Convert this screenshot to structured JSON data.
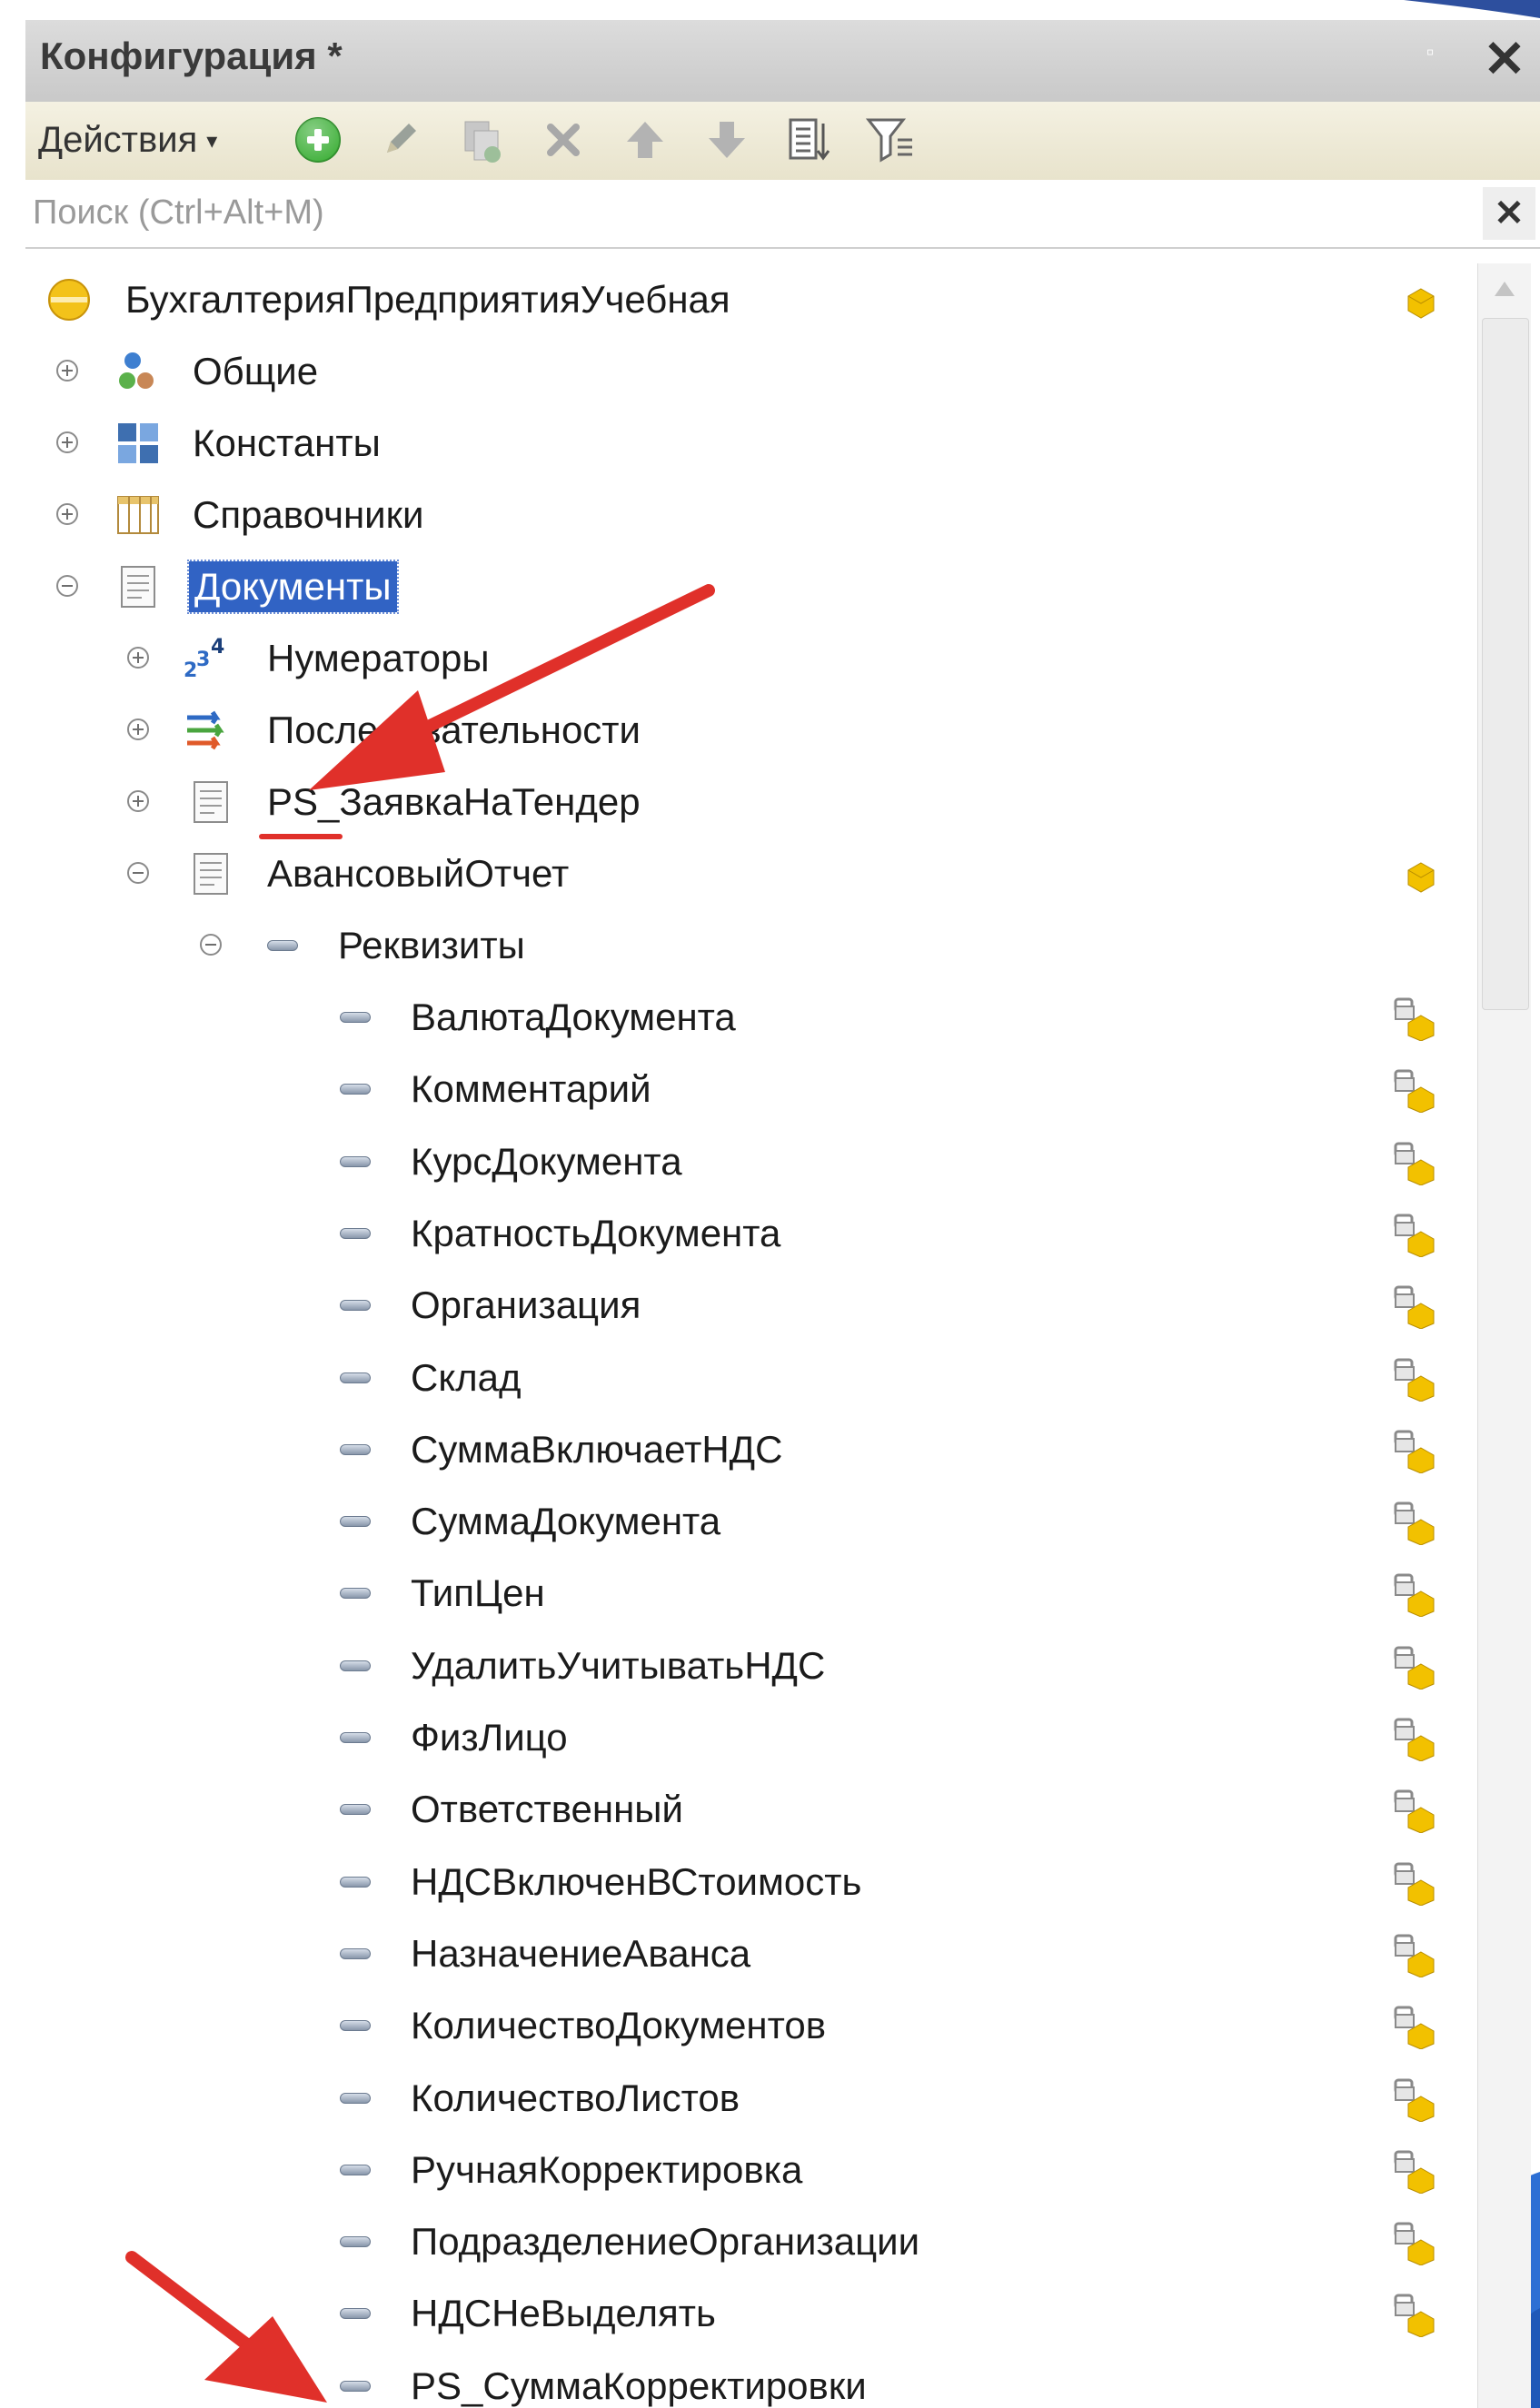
{
  "window": {
    "title": "Конфигурация *",
    "pin_glyph": "▫",
    "close_glyph": "✕"
  },
  "toolbar": {
    "actions_label": "Действия",
    "actions_caret": "▾",
    "buttons": [
      {
        "name": "add",
        "icon": "plus-circle-icon",
        "color": "#3fae3a"
      },
      {
        "name": "edit",
        "icon": "pencil-icon"
      },
      {
        "name": "copy",
        "icon": "copy-icon"
      },
      {
        "name": "delete",
        "icon": "delete-x-icon"
      },
      {
        "name": "move-up",
        "icon": "arrow-up-icon"
      },
      {
        "name": "move-down",
        "icon": "arrow-down-icon"
      },
      {
        "name": "sort",
        "icon": "sort-list-icon"
      },
      {
        "name": "filter",
        "icon": "filter-icon"
      }
    ]
  },
  "search": {
    "placeholder": "Поиск (Ctrl+Alt+M)",
    "value": "",
    "clear_glyph": "✕"
  },
  "tree": {
    "root": {
      "label": "БухгалтерияПредприятияУчебная",
      "icon": "configuration-icon"
    },
    "groups": [
      {
        "label": "Общие",
        "icon": "common-objects-icon",
        "expanded": false
      },
      {
        "label": "Константы",
        "icon": "constants-icon",
        "expanded": false
      },
      {
        "label": "Справочники",
        "icon": "catalogs-icon",
        "expanded": false
      },
      {
        "label": "Документы",
        "icon": "documents-icon",
        "expanded": true,
        "selected": true
      }
    ],
    "documents_children": [
      {
        "label": "Нумераторы",
        "icon": "numerators-icon",
        "expanded": false
      },
      {
        "label": "Последовательности",
        "icon": "sequences-icon",
        "expanded": false
      },
      {
        "label": "PS_ЗаявкаНаТендер",
        "icon": "document-icon",
        "expanded": false
      },
      {
        "label": "АвансовыйОтчет",
        "icon": "document-icon",
        "expanded": true
      }
    ],
    "attributes_group": {
      "label": "Реквизиты",
      "expanded": true
    },
    "attributes": [
      "ВалютаДокумента",
      "Комментарий",
      "КурсДокумента",
      "КратностьДокумента",
      "Организация",
      "Склад",
      "СуммаВключаетНДС",
      "СуммаДокумента",
      "ТипЦен",
      "УдалитьУчитыватьНДС",
      "ФизЛицо",
      "Ответственный",
      "НДСВключенВСтоимость",
      "НазначениеАванса",
      "КоличествоДокументов",
      "КоличествоЛистов",
      "РучнаяКорректировка",
      "ПодразделениеОрганизации",
      "НДСНеВыделять",
      "PS_СуммаКорректировки"
    ]
  },
  "colors": {
    "selection": "#3163c4",
    "annotation_arrow": "#e0302a",
    "support_cube": "#f2c100"
  }
}
